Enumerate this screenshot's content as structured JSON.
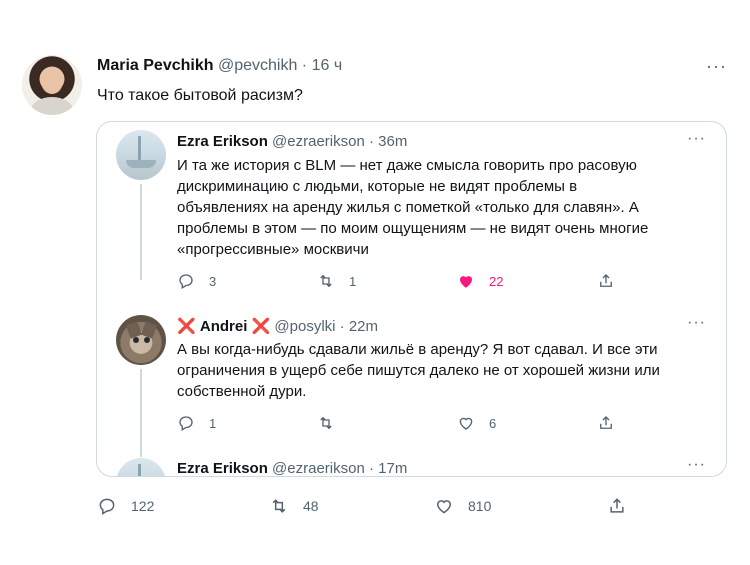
{
  "tweet": {
    "author_name": "Maria Pevchikh",
    "author_handle": "@pevchikh",
    "separator": "·",
    "time": "16 ч",
    "more_glyph": "···",
    "text": "Что такое бытовой расизм?",
    "stats": {
      "replies": "122",
      "retweets": "48",
      "likes": "810"
    }
  },
  "quoted_thread": [
    {
      "name": "Ezra Erikson",
      "handle": "@ezraerikson",
      "separator": "·",
      "time": "36m",
      "lines": [
        "И та же история с BLM — нет даже смысла говорить про расовую",
        "дискриминацию с людьми, которые не видят проблемы в",
        "объявлениях на аренду жилья с пометкой «только для славян». А",
        "проблемы в этом — по моим ощущениям — не видят очень многие",
        "«прогрессивные» москвичи"
      ],
      "replies": "3",
      "retweets": "1",
      "likes": "22",
      "liked": true
    },
    {
      "name_prefix": "❌",
      "name": "Andrei",
      "name_suffix": "❌",
      "handle": "@posylki",
      "separator": "·",
      "time": "22m",
      "lines": [
        "А вы когда-нибудь сдавали жильё в аренду? Я вот сдавал. И все эти",
        "ограничения в ущерб себе пишутся далеко не от хорошей жизни или",
        "собственной дури."
      ],
      "replies": "1",
      "retweets": "",
      "likes": "6",
      "liked": false
    },
    {
      "name": "Ezra Erikson",
      "handle": "@ezraerikson",
      "separator": "·",
      "time": "17m"
    }
  ],
  "icons": {
    "reply": "reply-icon",
    "retweet": "retweet-icon",
    "like": "heart-icon",
    "share": "share-icon",
    "more": "more-icon"
  },
  "colors": {
    "like_active": "#f91880",
    "cross": "#e0245e",
    "muted": "#536471",
    "border": "#cfd9de"
  }
}
